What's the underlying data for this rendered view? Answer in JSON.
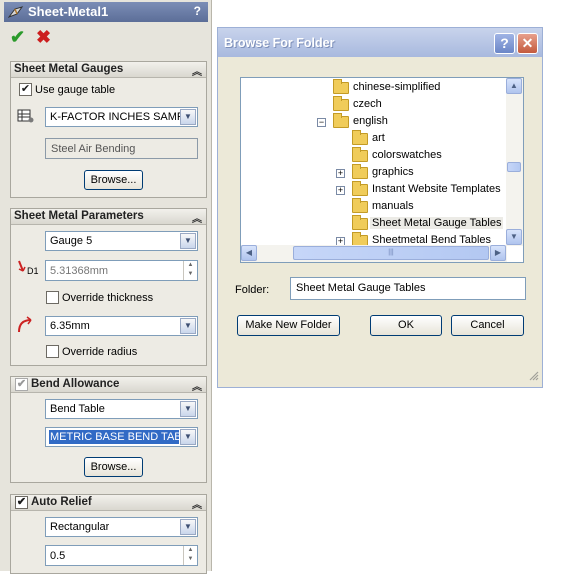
{
  "panel": {
    "title": "Sheet-Metal1",
    "help": "?",
    "ok_icon": "✔",
    "cancel_icon": "✖",
    "gauges": {
      "header": "Sheet Metal Gauges",
      "use_gauge_check": "✔",
      "use_gauge_label": "Use gauge table",
      "table_select": "K-FACTOR INCHES SAMPLE",
      "gauge_name": "Steel Air Bending",
      "browse": "Browse..."
    },
    "params": {
      "header": "Sheet Metal Parameters",
      "gauge_select": "Gauge 5",
      "thickness_value": "5.31368mm",
      "override_thickness": "Override thickness",
      "radius_select": "6.35mm",
      "override_radius": "Override radius",
      "d1_label": "D1"
    },
    "bend": {
      "header": "Bend Allowance",
      "check": "✔",
      "type_select": "Bend Table",
      "table_select": "METRIC BASE BEND TABLE",
      "browse": "Browse..."
    },
    "relief": {
      "header": "Auto Relief",
      "check": "✔",
      "type_select": "Rectangular",
      "ratio_value": "0.5"
    }
  },
  "dialog": {
    "title": "Browse For Folder",
    "help_button": "?",
    "close_button": "✕",
    "tree_items": [
      "chinese-simplified",
      "czech",
      "english",
      "art",
      "colorswatches",
      "graphics",
      "Instant Website Templates",
      "manuals",
      "Sheet Metal Gauge Tables",
      "Sheetmetal Bend Tables"
    ],
    "expand_minus": "−",
    "expand_plus": "+",
    "folder_label": "Folder:",
    "folder_value": "Sheet Metal Gauge Tables",
    "make_new_folder": "Make New Folder",
    "ok": "OK",
    "cancel": "Cancel",
    "scroll_grip": "|||"
  },
  "colors": {
    "selected_highlight": "#316ac5",
    "title_bar": "#6b7da6"
  }
}
